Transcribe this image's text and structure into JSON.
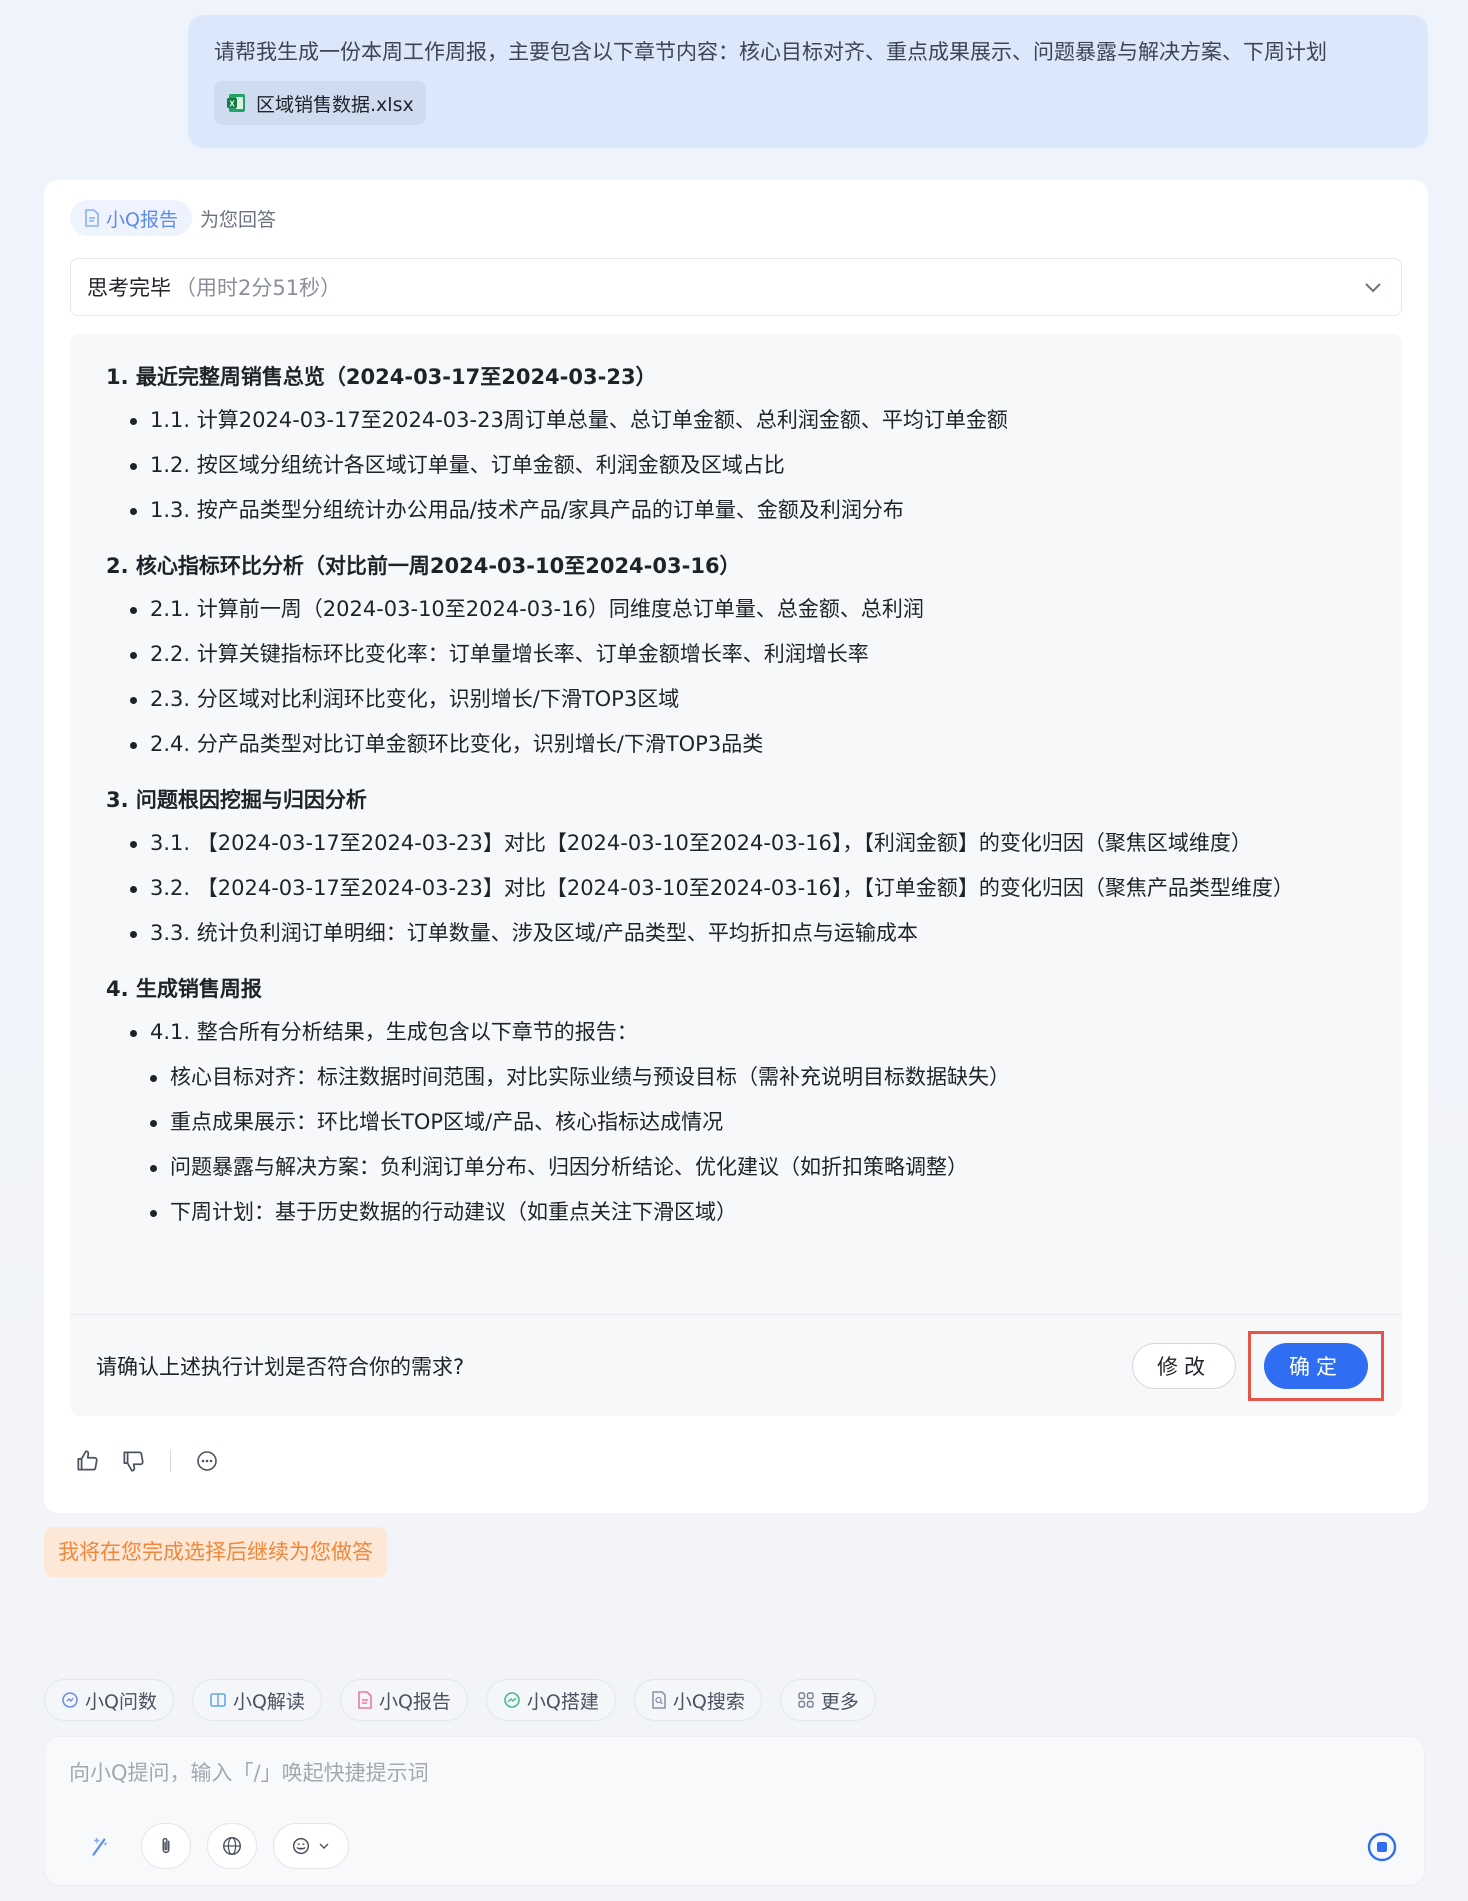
{
  "user_message": {
    "text": "请帮我生成一份本周工作周报，主要包含以下章节内容：核心目标对齐、重点成果展示、问题暴露与解决方案、下周计划",
    "attachment": "区域销售数据.xlsx"
  },
  "answer": {
    "agent_label": "小Q报告",
    "sub_label": "为您回答",
    "thinking": {
      "status": "思考完毕",
      "time": "（用时2分51秒）"
    },
    "plan": {
      "sections": [
        {
          "title": "1. 最近完整周销售总览（2024-03-17至2024-03-23）",
          "items": [
            "1.1. 计算2024-03-17至2024-03-23周订单总量、总订单金额、总利润金额、平均订单金额",
            "1.2. 按区域分组统计各区域订单量、订单金额、利润金额及区域占比",
            "1.3. 按产品类型分组统计办公用品/技术产品/家具产品的订单量、金额及利润分布"
          ]
        },
        {
          "title": "2. 核心指标环比分析（对比前一周2024-03-10至2024-03-16）",
          "items": [
            "2.1. 计算前一周（2024-03-10至2024-03-16）同维度总订单量、总金额、总利润",
            "2.2. 计算关键指标环比变化率：订单量增长率、订单金额增长率、利润增长率",
            "2.3. 分区域对比利润环比变化，识别增长/下滑TOP3区域",
            "2.4. 分产品类型对比订单金额环比变化，识别增长/下滑TOP3品类"
          ]
        },
        {
          "title": "3. 问题根因挖掘与归因分析",
          "items": [
            "3.1. 【2024-03-17至2024-03-23】对比【2024-03-10至2024-03-16】，【利润金额】的变化归因（聚焦区域维度）",
            "3.2. 【2024-03-17至2024-03-23】对比【2024-03-10至2024-03-16】，【订单金额】的变化归因（聚焦产品类型维度）",
            "3.3. 统计负利润订单明细：订单数量、涉及区域/产品类型、平均折扣点与运输成本"
          ]
        },
        {
          "title": "4. 生成销售周报",
          "items": [
            "4.1. 整合所有分析结果，生成包含以下章节的报告："
          ],
          "sub_items": [
            "核心目标对齐：标注数据时间范围，对比实际业绩与预设目标（需补充说明目标数据缺失）",
            "重点成果展示：环比增长TOP区域/产品、核心指标达成情况",
            "问题暴露与解决方案：负利润订单分布、归因分析结论、优化建议（如折扣策略调整）",
            "下周计划：基于历史数据的行动建议（如重点关注下滑区域）"
          ]
        }
      ]
    },
    "confirm": {
      "question": "请确认上述执行计划是否符合你的需求?",
      "modify_label": "修改",
      "confirm_label": "确定"
    }
  },
  "status_message": "我将在您完成选择后继续为您做答",
  "tools": [
    {
      "label": "小Q问数",
      "icon": "chat-data-icon",
      "color": "#6b8ff0"
    },
    {
      "label": "小Q解读",
      "icon": "book-icon",
      "color": "#5fa8e8"
    },
    {
      "label": "小Q报告",
      "icon": "report-icon",
      "color": "#e87aa0"
    },
    {
      "label": "小Q搭建",
      "icon": "build-icon",
      "color": "#4cb88a"
    },
    {
      "label": "小Q搜索",
      "icon": "search-doc-icon",
      "color": "#8a94a6"
    },
    {
      "label": "更多",
      "icon": "grid-icon",
      "color": "#7a8190"
    }
  ],
  "input": {
    "placeholder": "向小Q提问，输入「/」唤起快捷提示词"
  },
  "colors": {
    "accent": "#2f6ef2",
    "highlight_border": "#e5554a",
    "status_text": "#f0873a",
    "status_bg": "#fde8d8"
  }
}
